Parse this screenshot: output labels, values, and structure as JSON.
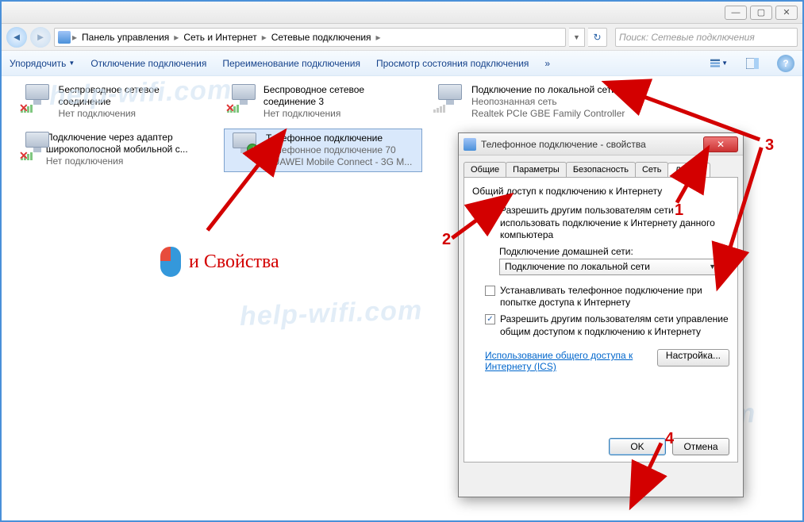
{
  "window": {
    "sys": {
      "min": "—",
      "max": "▢",
      "close": "✕"
    },
    "breadcrumb": {
      "seg1": "Панель управления",
      "seg2": "Сеть и Интернет",
      "seg3": "Сетевые подключения",
      "arrow": "▸",
      "refresh": "↻"
    },
    "search_placeholder": "Поиск: Сетевые подключения"
  },
  "toolbar": {
    "organize": "Упорядочить",
    "disable": "Отключение подключения",
    "rename": "Переименование подключения",
    "status": "Просмотр состояния подключения",
    "more": "»",
    "help": "?"
  },
  "connections": {
    "c1": {
      "title": "Беспроводное сетевое соединение",
      "sub1": "Нет подключения",
      "sub2": ""
    },
    "c2": {
      "title": "Беспроводное сетевое соединение 3",
      "sub1": "Нет подключения",
      "sub2": ""
    },
    "c3": {
      "title": "Подключение по локальной сети",
      "sub1": "Неопознанная сеть",
      "sub2": "Realtek PCIe GBE Family Controller"
    },
    "c4": {
      "title": "Подключение через адаптер широкополосной мобильной с...",
      "sub1": "Нет подключения",
      "sub2": ""
    },
    "c5": {
      "title": "Телефонное подключение",
      "sub1": "Телефонное подключение 70",
      "sub2": "HUAWEI Mobile Connect - 3G M..."
    }
  },
  "dialog": {
    "title": "Телефонное подключение - свойства",
    "close": "✕",
    "tabs": {
      "general": "Общие",
      "params": "Параметры",
      "security": "Безопасность",
      "network": "Сеть",
      "sharing": "Доступ"
    },
    "group": "Общий доступ к подключению к Интернету",
    "opt1": "Разрешить другим пользователям сети использовать подключение к Интернету данного компьютера",
    "home_label": "Подключение домашней сети:",
    "combo": "Подключение по локальной сети",
    "opt2": "Устанавливать телефонное подключение при попытке доступа к Интернету",
    "opt3": "Разрешить другим пользователям сети управление общим доступом к подключению к Интернету",
    "link": "Использование общего доступа к Интернету (ICS)",
    "settings": "Настройка...",
    "ok": "OK",
    "cancel": "Отмена"
  },
  "annotations": {
    "n1": "1",
    "n2": "2",
    "n3": "3",
    "n4": "4",
    "hint": "и Свойства",
    "watermark": "help-wifi.com"
  }
}
